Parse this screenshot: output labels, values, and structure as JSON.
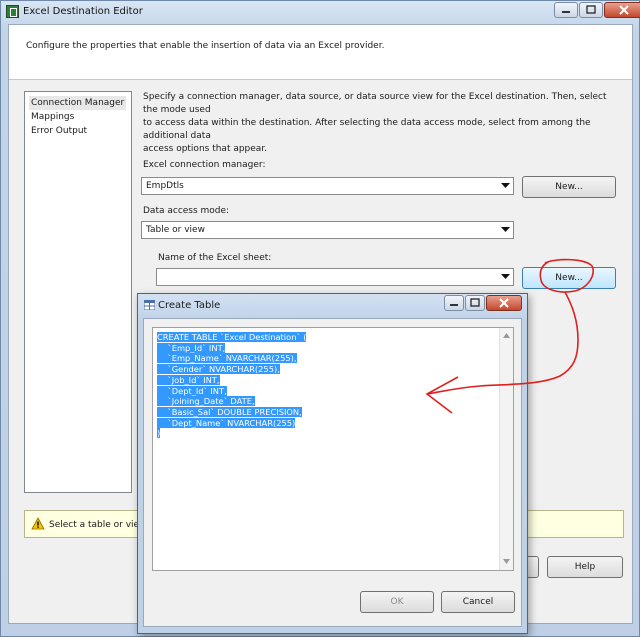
{
  "window": {
    "title": "Excel Destination Editor"
  },
  "header": {
    "description": "Configure the properties that enable the insertion of data via an Excel provider."
  },
  "nav": {
    "items": [
      "Connection Manager",
      "Mappings",
      "Error Output"
    ]
  },
  "main": {
    "description_lines": [
      "Specify a connection manager, data source, or data source view for the Excel destination. Then, select the mode used",
      "to access data within the destination. After selecting the data access mode, select from among the additional data",
      "access options that appear."
    ],
    "connection_manager_label": "Excel connection manager:",
    "connection_manager_value": "EmpDtls",
    "new_button_1": "New...",
    "access_mode_label": "Data access mode:",
    "access_mode_value": "Table or view",
    "sheet_label": "Name of the Excel sheet:",
    "sheet_value": "",
    "new_button_2": "New..."
  },
  "status": {
    "message": "Select a table or view f"
  },
  "footer": {
    "help_button": "Help"
  },
  "dialog": {
    "title": "Create Table",
    "sql": [
      "CREATE TABLE `Excel Destination` (",
      "    `Emp_Id` INT,",
      "    `Emp_Name` NVARCHAR(255),",
      "    `Gender` NVARCHAR(255),",
      "    `Job_Id` INT,",
      "    `Dept_Id` INT,",
      "    `Joining_Date` DATE,",
      "    `Basic_Sal` DOUBLE PRECISION,",
      "    `Dept_Name` NVARCHAR(255)",
      ")"
    ],
    "ok_button": "OK",
    "cancel_button": "Cancel"
  },
  "colors": {
    "selection": "#3399ff",
    "annotation": "#e0201e",
    "status_background": "#ffffe1"
  },
  "icons": [
    "application-icon",
    "minimize-icon",
    "maximize-icon",
    "close-icon",
    "dropdown-arrow-icon",
    "warning-icon",
    "table-icon"
  ]
}
